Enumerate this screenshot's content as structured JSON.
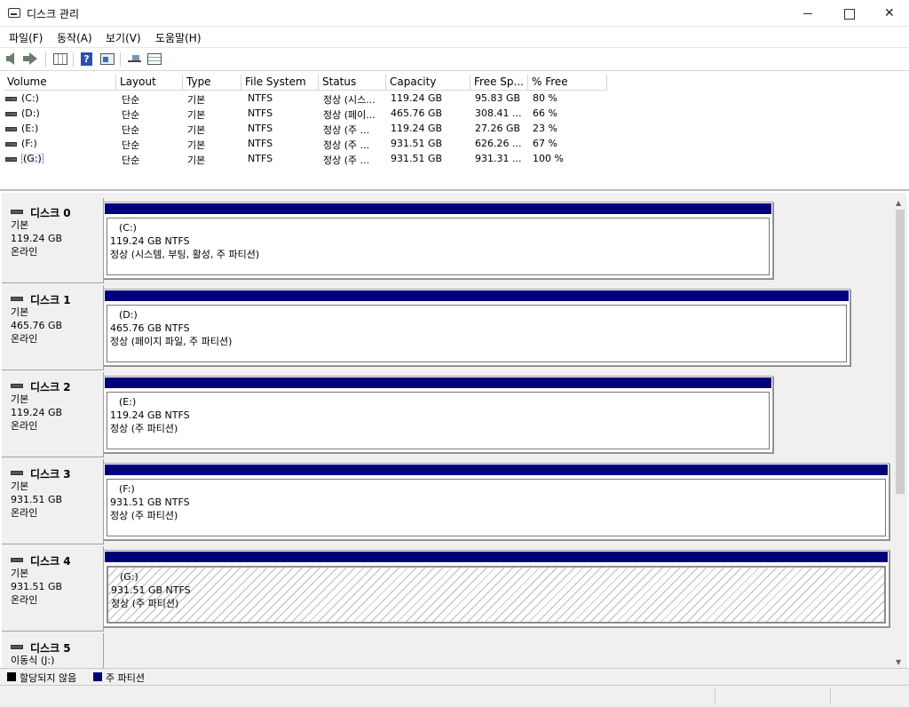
{
  "window": {
    "title": "디스크 관리",
    "min_label": "",
    "max_label": "",
    "close_label": "✕"
  },
  "menu": [
    "파일(F)",
    "동작(A)",
    "보기(V)",
    "도움말(H)"
  ],
  "columns": [
    "Volume",
    "Layout",
    "Type",
    "File System",
    "Status",
    "Capacity",
    "Free Sp...",
    "% Free"
  ],
  "volumes": [
    {
      "name": "(C:)",
      "layout": "단순",
      "type": "기본",
      "fs": "NTFS",
      "status": "정상 (시스...",
      "capacity": "119.24 GB",
      "free": "95.83 GB",
      "pct": "80 %"
    },
    {
      "name": "(D:)",
      "layout": "단순",
      "type": "기본",
      "fs": "NTFS",
      "status": "정상 (페이...",
      "capacity": "465.76 GB",
      "free": "308.41 ...",
      "pct": "66 %"
    },
    {
      "name": "(E:)",
      "layout": "단순",
      "type": "기본",
      "fs": "NTFS",
      "status": "정상 (주 ...",
      "capacity": "119.24 GB",
      "free": "27.26 GB",
      "pct": "23 %"
    },
    {
      "name": "(F:)",
      "layout": "단순",
      "type": "기본",
      "fs": "NTFS",
      "status": "정상 (주 ...",
      "capacity": "931.51 GB",
      "free": "626.26 ...",
      "pct": "67 %"
    },
    {
      "name": "(G:)",
      "layout": "단순",
      "type": "기본",
      "fs": "NTFS",
      "status": "정상 (주 ...",
      "capacity": "931.51 GB",
      "free": "931.31 ...",
      "pct": "100 %"
    }
  ],
  "disks": [
    {
      "name": "디스크 0",
      "type": "기본",
      "size": "119.24 GB",
      "state": "온라인",
      "part_name": "(C:)",
      "part_size": "119.24 GB NTFS",
      "part_status": "정상 (시스템, 부팅, 활성, 주 파티션)"
    },
    {
      "name": "디스크 1",
      "type": "기본",
      "size": "465.76 GB",
      "state": "온라인",
      "part_name": "(D:)",
      "part_size": "465.76 GB NTFS",
      "part_status": "정상 (페이지 파일, 주 파티션)"
    },
    {
      "name": "디스크 2",
      "type": "기본",
      "size": "119.24 GB",
      "state": "온라인",
      "part_name": "(E:)",
      "part_size": "119.24 GB NTFS",
      "part_status": "정상 (주 파티션)"
    },
    {
      "name": "디스크 3",
      "type": "기본",
      "size": "931.51 GB",
      "state": "온라인",
      "part_name": "(F:)",
      "part_size": "931.51 GB NTFS",
      "part_status": "정상 (주 파티션)"
    },
    {
      "name": "디스크 4",
      "type": "기본",
      "size": "931.51 GB",
      "state": "온라인",
      "part_name": "(G:)",
      "part_size": "931.51 GB NTFS",
      "part_status": "정상 (주 파티션)"
    },
    {
      "name": "디스크 5",
      "type": "이동식 (J:)"
    }
  ],
  "legend": {
    "unallocated": "할당되지 않음",
    "primary": "주 파티션"
  },
  "colors": {
    "primary_partition": "#00007b",
    "unallocated": "#000000",
    "pane_bg": "#f0f0f0"
  },
  "icons": [
    "disk-management-app-icon",
    "back-icon",
    "forward-icon",
    "console-tree-icon",
    "help-icon",
    "properties-icon",
    "connect-icon",
    "list-view-icon"
  ]
}
